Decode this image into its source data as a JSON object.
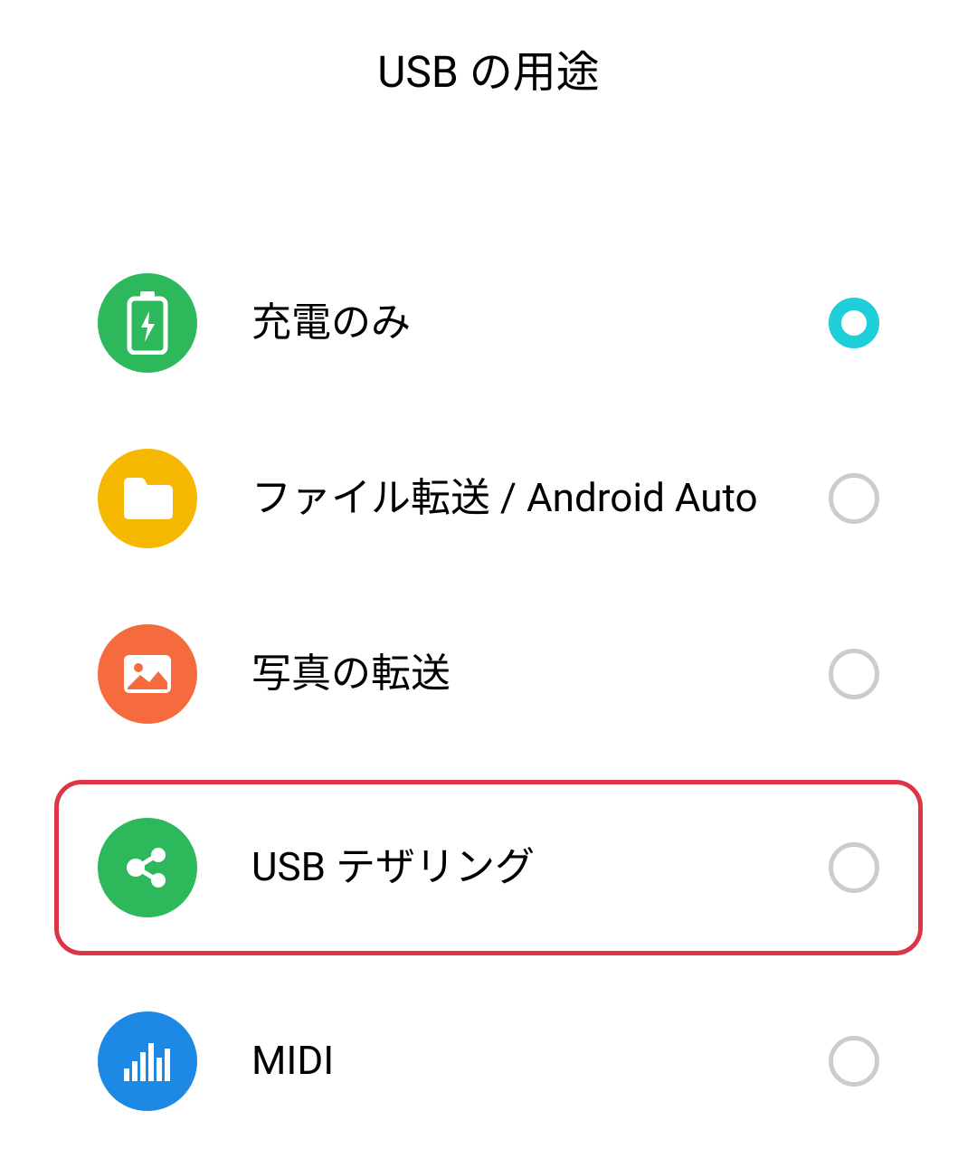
{
  "title": "USB の用途",
  "options": [
    {
      "label": "充電のみ",
      "selected": true
    },
    {
      "label": "ファイル転送 / Android Auto",
      "selected": false
    },
    {
      "label": "写真の転送",
      "selected": false
    },
    {
      "label": "USB テザリング",
      "selected": false,
      "highlighted": true
    },
    {
      "label": "MIDI",
      "selected": false
    }
  ],
  "colors": {
    "battery": "#2eb85c",
    "folder": "#f5b700",
    "image": "#f56b3d",
    "share": "#2eb85c",
    "midi": "#1e88e5",
    "radioSelected": "#1ecfd9",
    "highlight": "#dc3545"
  }
}
